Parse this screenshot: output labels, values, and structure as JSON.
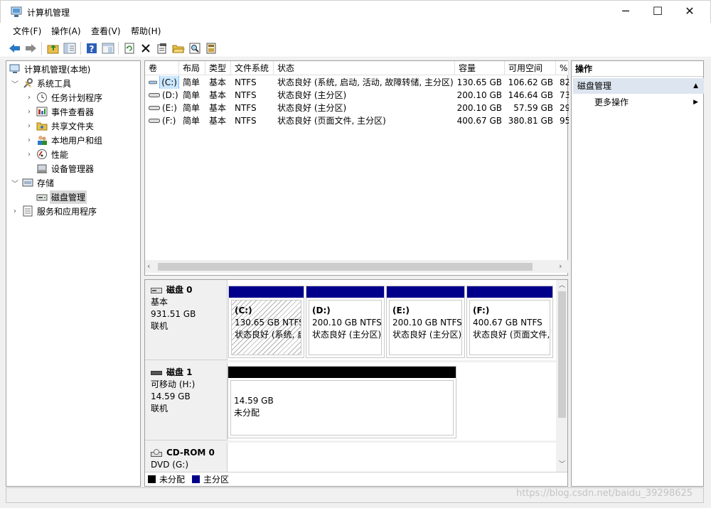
{
  "window": {
    "title": "计算机管理",
    "minimize_glyph": "─",
    "maximize_glyph": "☐",
    "close_glyph": "✕"
  },
  "menu": [
    "文件(F)",
    "操作(A)",
    "查看(V)",
    "帮助(H)"
  ],
  "toolbar_icons": [
    "back-arrow-icon",
    "forward-arrow-icon",
    "up-folder-icon",
    "show-hide-tree-icon",
    "help-icon",
    "properties-icon",
    "refresh-icon",
    "delete-icon",
    "properties-doc-icon",
    "open-folder-icon",
    "search-icon",
    "export-list-icon"
  ],
  "tree": {
    "root": "计算机管理(本地)",
    "system_tools": "系统工具",
    "task_scheduler": "任务计划程序",
    "event_viewer": "事件查看器",
    "shared_folders": "共享文件夹",
    "local_users": "本地用户和组",
    "performance": "性能",
    "device_manager": "设备管理器",
    "storage": "存储",
    "disk_management": "磁盘管理",
    "services_apps": "服务和应用程序"
  },
  "volume_table": {
    "headers": [
      "卷",
      "布局",
      "类型",
      "文件系统",
      "状态",
      "容量",
      "可用空间",
      "%"
    ],
    "rows": [
      {
        "vol": "(C:)",
        "layout": "简单",
        "type": "基本",
        "fs": "NTFS",
        "status": "状态良好 (系统, 启动, 活动, 故障转储, 主分区)",
        "capacity": "130.65 GB",
        "free": "106.62 GB",
        "pct": "82"
      },
      {
        "vol": "(D:)",
        "layout": "简单",
        "type": "基本",
        "fs": "NTFS",
        "status": "状态良好 (主分区)",
        "capacity": "200.10 GB",
        "free": "146.64 GB",
        "pct": "73"
      },
      {
        "vol": "(E:)",
        "layout": "简单",
        "type": "基本",
        "fs": "NTFS",
        "status": "状态良好 (主分区)",
        "capacity": "200.10 GB",
        "free": "57.59 GB",
        "pct": "29"
      },
      {
        "vol": "(F:)",
        "layout": "简单",
        "type": "基本",
        "fs": "NTFS",
        "status": "状态良好 (页面文件, 主分区)",
        "capacity": "400.67 GB",
        "free": "380.81 GB",
        "pct": "95"
      }
    ]
  },
  "disks": [
    {
      "name": "磁盘 0",
      "kind": "基本",
      "size": "931.51 GB",
      "state": "联机",
      "partitions": [
        {
          "label": "(C:)",
          "size": "130.65 GB NTFS",
          "status": "状态良好 (系统, 启"
        },
        {
          "label": "(D:)",
          "size": "200.10 GB NTFS",
          "status": "状态良好 (主分区)"
        },
        {
          "label": "(E:)",
          "size": "200.10 GB NTFS",
          "status": "状态良好 (主分区)"
        },
        {
          "label": "(F:)",
          "size": "400.67 GB NTFS",
          "status": "状态良好 (页面文件,"
        }
      ]
    },
    {
      "name": "磁盘 1",
      "kind": "可移动 (H:)",
      "size": "14.59 GB",
      "state": "联机",
      "partitions": [
        {
          "size": "14.59 GB",
          "status": "未分配"
        }
      ]
    },
    {
      "name": "CD-ROM 0",
      "kind": "DVD (G:)"
    }
  ],
  "legend": {
    "unallocated": "未分配",
    "primary": "主分区",
    "unallocated_color": "#000000",
    "primary_color": "#00008b"
  },
  "actions": {
    "title": "操作",
    "group": "磁盘管理",
    "more": "更多操作"
  },
  "watermark": "https://blog.csdn.net/baidu_39298625"
}
